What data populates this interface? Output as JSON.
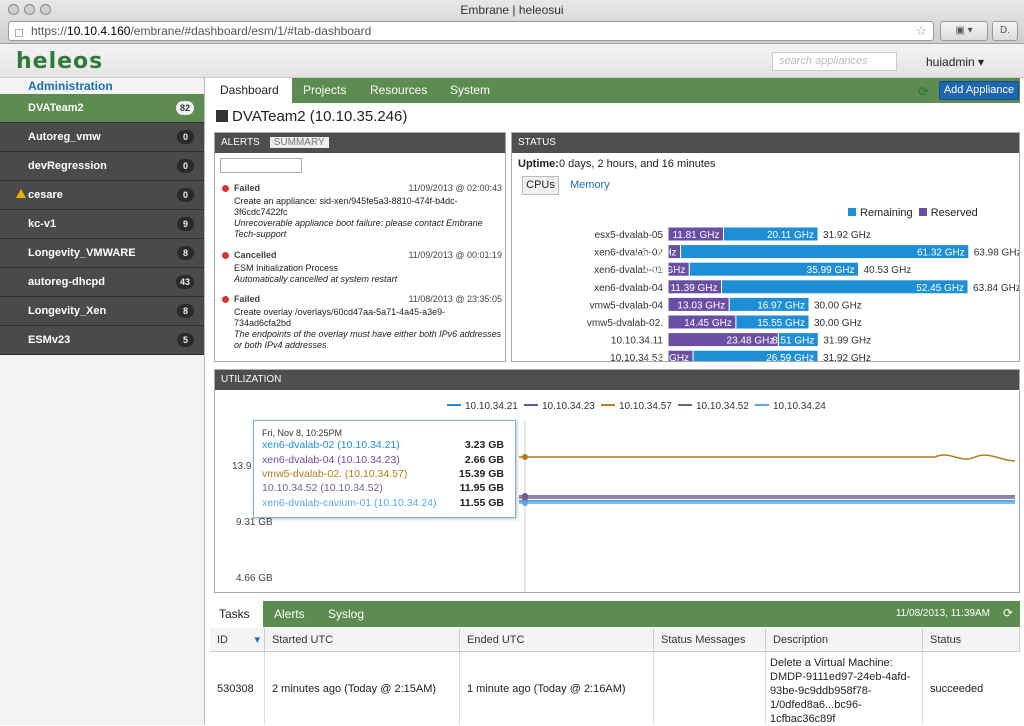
{
  "browser": {
    "window_title": "Embrane | heleosui",
    "url_prefix": "https://",
    "url_host": "10.10.4.160",
    "url_path": "/embrane/#dashboard/esm/1/#tab-dashboard"
  },
  "header": {
    "logo": "heleos",
    "search_placeholder": "search appliances",
    "user": "huiadmin ▾"
  },
  "sidebar": {
    "section": "Administration",
    "items": [
      {
        "label": "DVATeam2",
        "count": "82",
        "active": true
      },
      {
        "label": "Autoreg_vmw",
        "count": "0"
      },
      {
        "label": "devRegression",
        "count": "0"
      },
      {
        "label": "cesare",
        "count": "0",
        "warning": true
      },
      {
        "label": "kc-v1",
        "count": "9"
      },
      {
        "label": "Longevity_VMWARE",
        "count": "8"
      },
      {
        "label": "autoreg-dhcpd",
        "count": "43"
      },
      {
        "label": "Longevity_Xen",
        "count": "8"
      },
      {
        "label": "ESMv23",
        "count": "5"
      }
    ]
  },
  "main_tabs": [
    "Dashboard",
    "Projects",
    "Resources",
    "System"
  ],
  "add_appliance": "Add Appliance",
  "page_title": "DVATeam2 (10.10.35.246)",
  "alerts": {
    "tabs": [
      "ALERTS",
      "SUMMARY"
    ],
    "items": [
      {
        "status": "Failed",
        "date": "11/09/2013 @ 02:00:43",
        "desc": "Create an appliance: sid-xen/945fe5a3-8810-474f-b4dc-3f6cdc7422fc",
        "error": "Unrecoverable appliance boot failure: please contact Embrane Tech-support"
      },
      {
        "status": "Cancelled",
        "date": "11/09/2013 @ 00:01:19",
        "desc": "ESM Initialization Process",
        "error": "Automatically cancelled at system restart"
      },
      {
        "status": "Failed",
        "date": "11/08/2013 @ 23:35:05",
        "desc": "Create overlay /overlays/60cd47aa-5a71-4a45-a3e9-734ad6cfa2bd",
        "error": "The endpoints of the overlay must have either both IPv6 addresses or both IPv4 addresses"
      }
    ]
  },
  "status": {
    "header": "STATUS",
    "uptime_label": "Uptime:",
    "uptime_value": "0 days, 2 hours, and 16 minutes",
    "tabs": [
      "CPUs",
      "Memory"
    ],
    "legend": [
      "Remaining",
      "Reserved"
    ],
    "colors": {
      "remaining": "#1e8fd4",
      "reserved": "#6a4ea3"
    }
  },
  "chart_data": [
    {
      "type": "bar",
      "stacked": true,
      "orientation": "horizontal",
      "categories": [
        "esx5-dvalab-05",
        "xen6-dvalab-02",
        "xen6-dvalab-01",
        "xen6-dvalab-04",
        "vmw5-dvalab-04",
        "vmw5-dvalab-02.",
        "10.10.34.11",
        "10.10.34.52"
      ],
      "series": [
        {
          "name": "Reserved",
          "values": [
            11.81,
            2.67,
            4.54,
            11.39,
            13.03,
            14.45,
            23.48,
            5.33
          ],
          "labels": [
            "11.81 GHz",
            "2.67 GHz",
            "4.54 GHz",
            "11.39 GHz",
            "13.03 GHz",
            "14.45 GHz",
            "23.48 GHz",
            "5.33 GHz"
          ]
        },
        {
          "name": "Remaining",
          "values": [
            20.11,
            61.32,
            35.99,
            52.45,
            16.97,
            15.55,
            8.51,
            26.59
          ],
          "labels": [
            "20.11 GHz",
            "61.32 GHz",
            "35.99 GHz",
            "52.45 GHz",
            "16.97 GHz",
            "15.55 GHz",
            "8.51 GHz",
            "26.59 GHz"
          ]
        }
      ],
      "totals": [
        "31.92 GHz",
        "63.98 GHz",
        "40.53 GHz",
        "63.84 GHz",
        "30.00 GHz",
        "30.00 GHz",
        "31.99 GHz",
        "31.92 GHz"
      ]
    },
    {
      "type": "line",
      "title": "UTILIZATION",
      "y_ticks": [
        "13.9",
        "9.31 GB",
        "4.66 GB"
      ],
      "series": [
        {
          "name": "10.10.34.21",
          "color": "#1e8fd4"
        },
        {
          "name": "10.10.34.23",
          "color": "#6a4ea3"
        },
        {
          "name": "10.10.34.57",
          "color": "#b07d1a"
        },
        {
          "name": "10.10.34.52",
          "color": "#7a5e8e"
        },
        {
          "name": "10.10.34.24",
          "color": "#5aa9e6"
        }
      ],
      "tooltip": {
        "time": "Fri, Nov 8, 10:25PM",
        "rows": [
          {
            "label": "xen6-dvalab-02 (10.10.34.21)",
            "value": "3.23 GB",
            "color": "#1e8fd4"
          },
          {
            "label": "xen6-dvalab-04 (10.10.34.23)",
            "value": "2.66 GB",
            "color": "#6a4ea3"
          },
          {
            "label": "vmw5-dvalab-02. (10.10.34.57)",
            "value": "15.39 GB",
            "color": "#b07d1a"
          },
          {
            "label": "10.10.34.52 (10.10.34.52)",
            "value": "11.95 GB",
            "color": "#7a5e8e"
          },
          {
            "label": "xen6-dvalab-cavium-01 (10.10.34.24)",
            "value": "11.55 GB",
            "color": "#5aa9e6"
          }
        ]
      }
    }
  ],
  "bottom": {
    "tabs": [
      "Tasks",
      "Alerts",
      "Syslog"
    ],
    "datetime": "11/08/2013, 11:39AM",
    "columns": [
      "ID",
      "Started UTC",
      "Ended UTC",
      "Status Messages",
      "Description",
      "Status"
    ],
    "rows": [
      {
        "id": "530308",
        "started": "2 minutes ago (Today @ 2:15AM)",
        "ended": "1 minute ago (Today @ 2:16AM)",
        "messages": "",
        "description": "Delete a Virtual Machine: DMDP-9111ed97-24eb-4afd-93be-9c9ddb958f78-1/0dfed8a6...bc96-1cfbac36c89f",
        "status": "succeeded"
      }
    ]
  }
}
